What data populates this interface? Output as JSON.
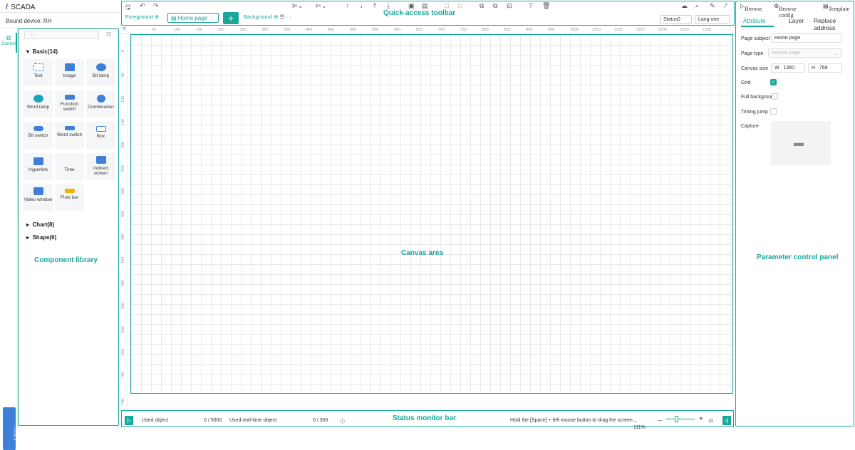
{
  "app": {
    "title": "SCADA",
    "bound_device": "Bound device: RH"
  },
  "rail": {
    "tab_label": "Control",
    "legacy_label": "LEGACY"
  },
  "library": {
    "label": "Component library",
    "search_placeholder": "",
    "basic_header": "Basic(14)",
    "chart_header": "Chart(8)",
    "shape_header": "Shape(6)",
    "items": [
      "Text",
      "Image",
      "Bit lamp",
      "Word lamp",
      "Function switch",
      "Combination",
      "Bit switch",
      "Word switch",
      "Box",
      "Hyperlink",
      "Time",
      "Indirect screen",
      "Video window",
      "Flow bar"
    ]
  },
  "toolbar": {
    "label": "Quick-access toolbar",
    "foreground": "Foreground",
    "home_tab": "Home page",
    "plus": "+",
    "background": "Background",
    "status_select": "Status0",
    "lang_select": "Lang one"
  },
  "ruler": {
    "top": [
      "50",
      "100",
      "150",
      "200",
      "250",
      "300",
      "350",
      "400",
      "450",
      "500",
      "550",
      "600",
      "650",
      "700",
      "750",
      "800",
      "850",
      "900",
      "950",
      "1000",
      "1050",
      "1100",
      "1150",
      "1200",
      "1250",
      "1300"
    ],
    "left": [
      "0",
      "50",
      "100",
      "150",
      "200",
      "250",
      "300",
      "350",
      "400",
      "450",
      "500",
      "550",
      "600",
      "650",
      "700",
      "738"
    ]
  },
  "canvas": {
    "label": "Canvas area"
  },
  "status_bar": {
    "label": "Status monitor bar",
    "used_object": "Used object",
    "used_object_count": "0 / 5000",
    "used_realtime": "Used real-time object",
    "used_realtime_count": "0 / 300",
    "hint": "Hold the [Space] + left mouse button to drag the screen",
    "zoom": "111%"
  },
  "right_panel": {
    "label": "Parameter control panel",
    "browse": "Browse",
    "browse_config": "Browse config",
    "template": "Template",
    "tabs": [
      "Attribute",
      "Layer",
      "Replace address"
    ],
    "page_subject_label": "Page subject",
    "page_subject_value": "Home page",
    "page_type_label": "Page type",
    "page_type_value": "Normal page",
    "canvas_size_label": "Canvas size",
    "w_label": "W",
    "w_value": "1360",
    "h_label": "H",
    "h_value": "768",
    "grid_label": "Grid",
    "full_bg_label": "Full backgrour",
    "timing_label": "Timing jump",
    "capture_label": "Capture"
  },
  "colors": {
    "accent": "#16a89b",
    "tile_icon": "#3d7fd9"
  }
}
